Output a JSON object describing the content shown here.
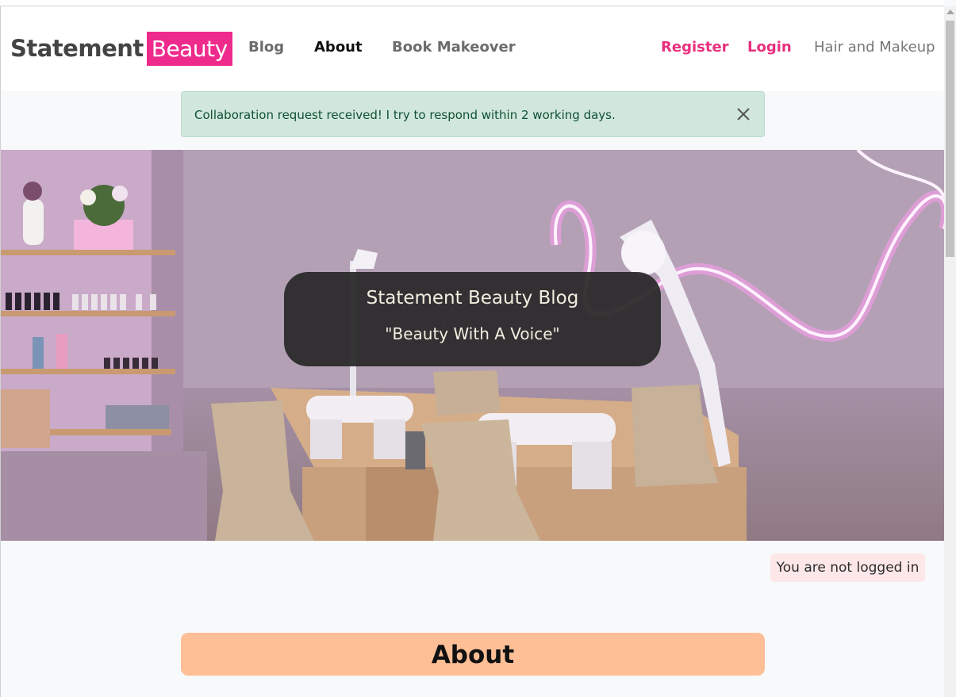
{
  "navbar": {
    "brand_part1": "Statement",
    "brand_part2": "Beauty",
    "links": {
      "blog": "Blog",
      "about": "About",
      "book": "Book Makeover",
      "register": "Register",
      "login": "Login",
      "hair_makeup": "Hair and Makeup"
    }
  },
  "alert": {
    "message": "Collaboration request received! I try to respond within 2 working days.",
    "close_icon": "close-icon"
  },
  "hero": {
    "title": "Statement Beauty Blog",
    "subtitle": "\"Beauty With A Voice\""
  },
  "status": {
    "text": "You are not logged in"
  },
  "section": {
    "heading": "About"
  },
  "colors": {
    "brand_pink": "#ee2b8c",
    "link_pink": "#e8307f",
    "alert_bg": "#d1e7dd",
    "about_bg": "#ffbf96",
    "badge_bg": "#fde7e9"
  }
}
